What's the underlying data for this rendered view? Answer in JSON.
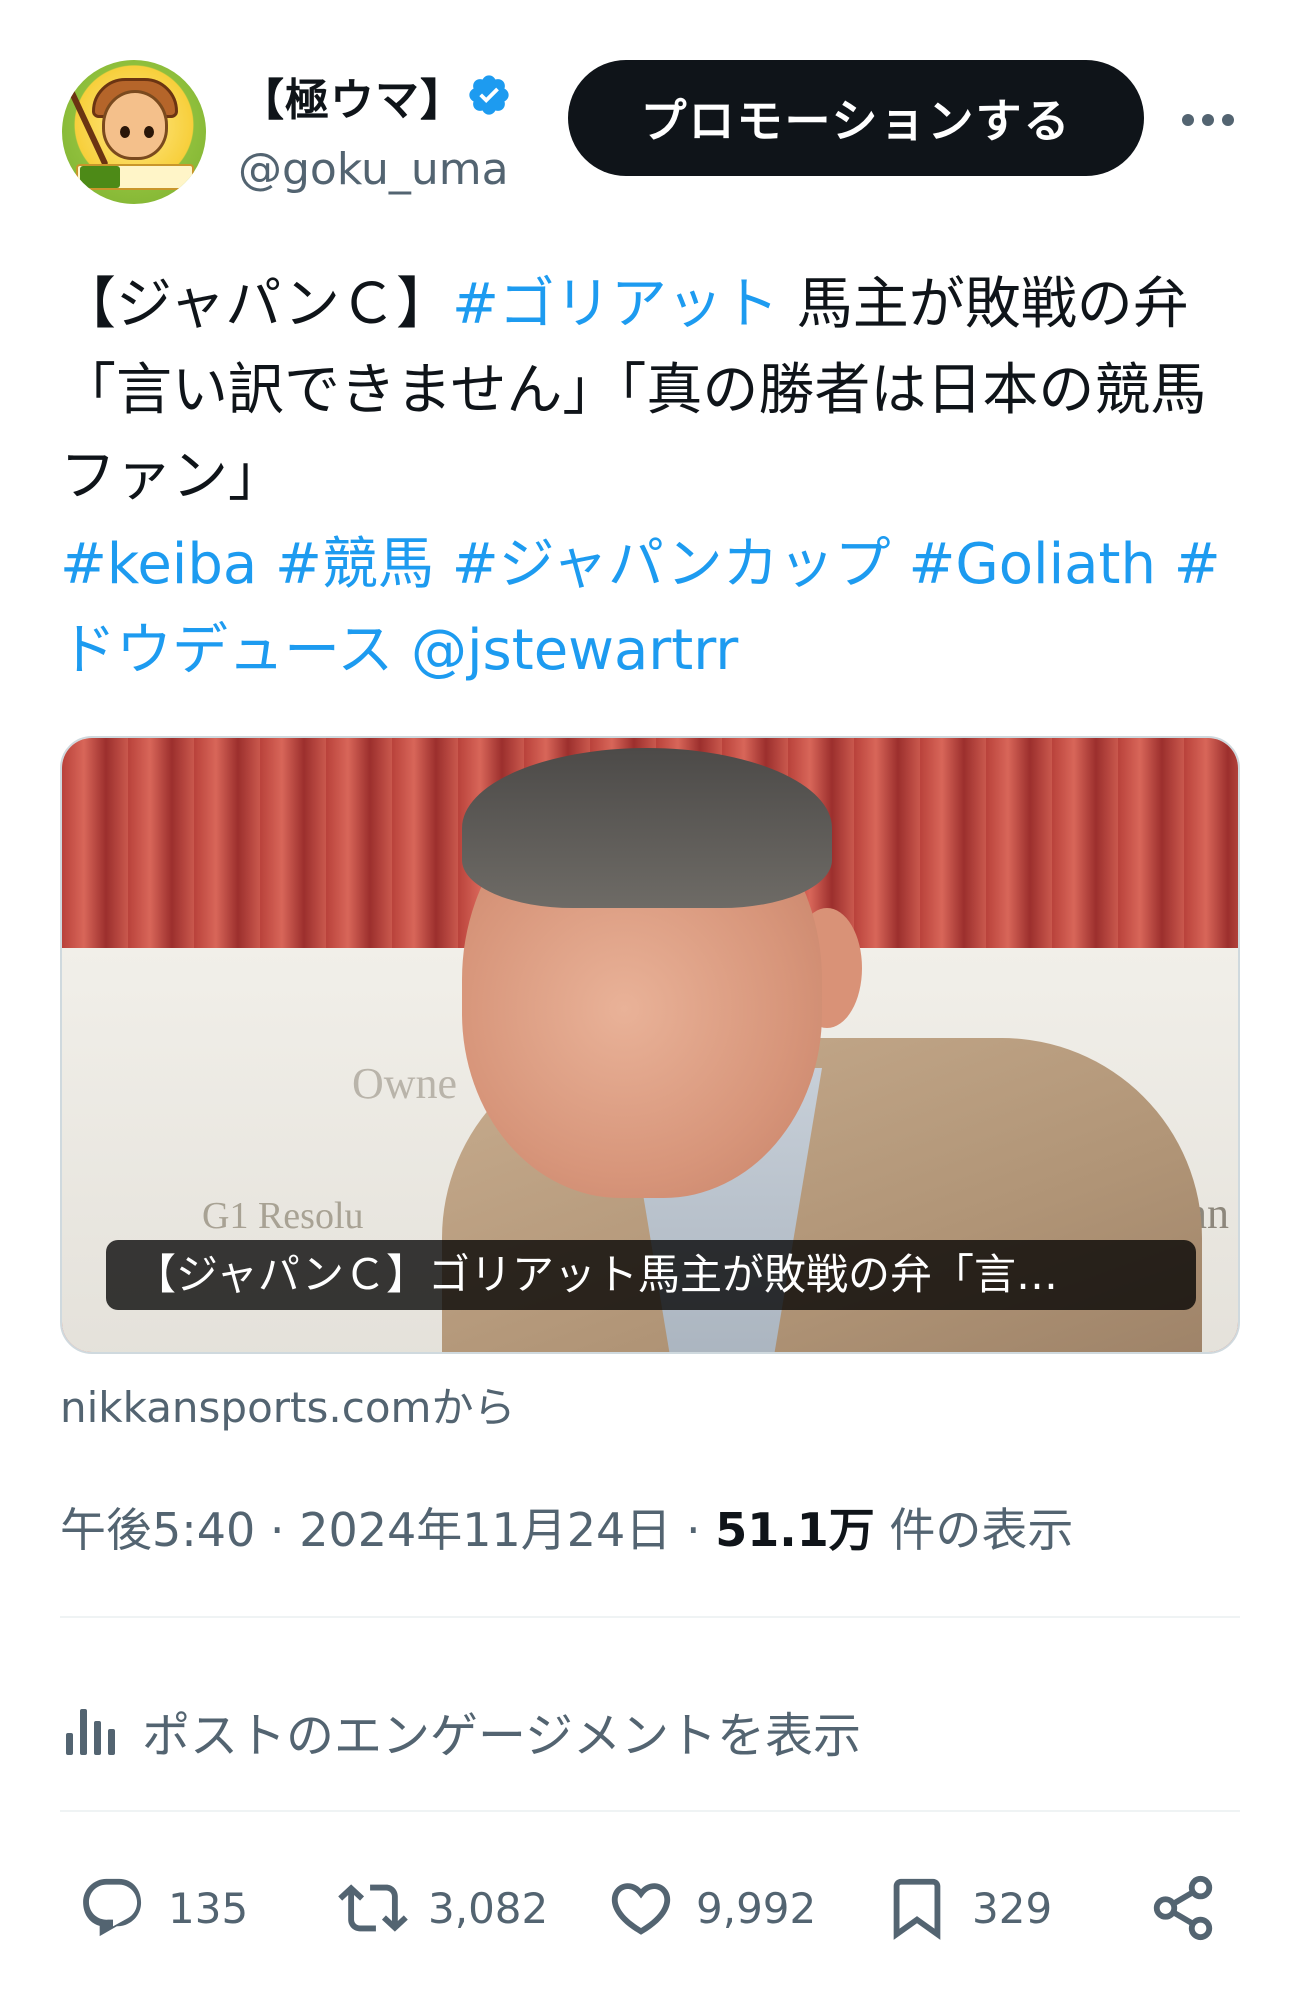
{
  "author": {
    "name": "【極ウマ】",
    "handle": "@goku_uma",
    "verified": true
  },
  "promote_button": "プロモーションする",
  "tweet": {
    "text_part1": "【ジャパンＣ】",
    "hashtag_goliath_jp": "#ゴリアット",
    "text_part2": " 馬主が敗戦の弁「言い訳できません」「真の勝者は日本の競馬ファン」",
    "tags_line": "#keiba #競馬 #ジャパンカップ #Goliath #ドウデュース @jstewartrr"
  },
  "card": {
    "caption": "【ジャパンＣ】ゴリアット馬主が敗戦の弁「言…",
    "backdrop_text_1": "Owne",
    "backdrop_text_2": "G1    Resolu",
    "backdrop_text_3": "n Ullmann",
    "source": "nikkansports.comから"
  },
  "meta": {
    "time": "午後5:40",
    "date": "2024年11月24日",
    "views": "51.1万",
    "views_label": "件の表示"
  },
  "engagement_link": "ポストのエンゲージメントを表示",
  "actions": {
    "replies": "135",
    "reposts": "3,082",
    "likes": "9,992",
    "bookmarks": "329"
  },
  "colors": {
    "link": "#1d9bf0",
    "text": "#0f1419",
    "secondary": "#536471",
    "divider": "#eff3f4"
  }
}
